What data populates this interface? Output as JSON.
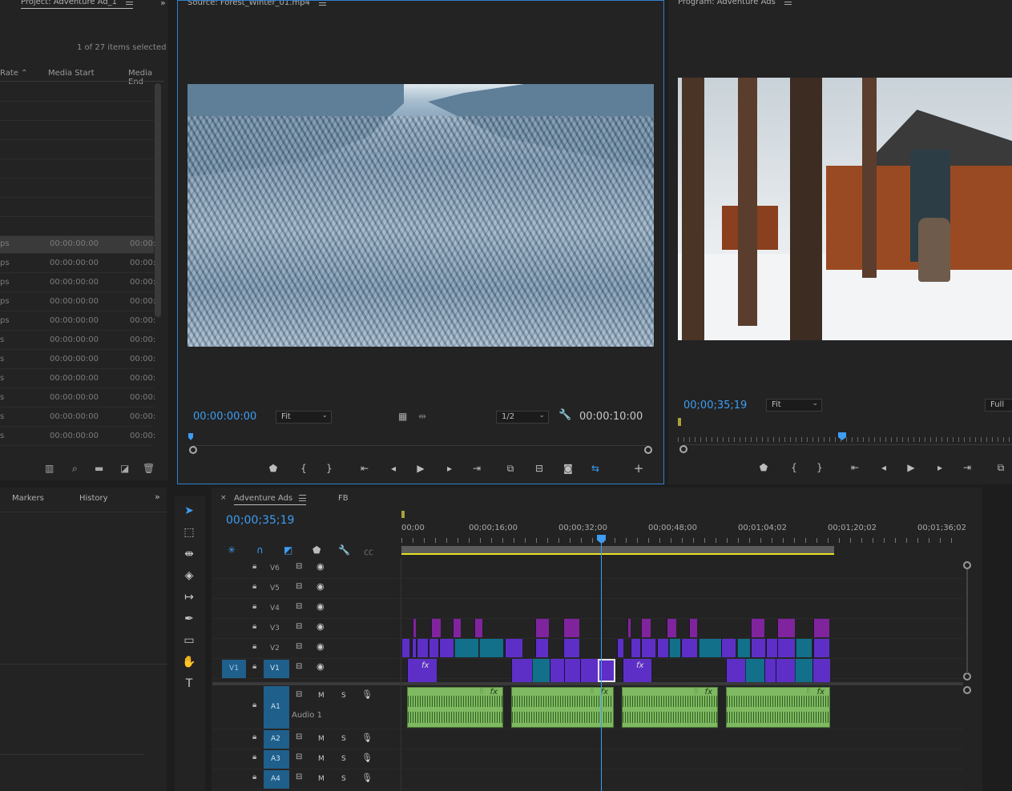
{
  "project": {
    "tab": "Project: Adventure Ad_1",
    "selection": "1 of 27 items selected",
    "columns": [
      "Rate",
      "Media Start",
      "Media End"
    ],
    "rows": [
      {
        "rate": "ps",
        "start": "00:00:00:00",
        "end": "00:00:"
      },
      {
        "rate": "ps",
        "start": "00:00:00:00",
        "end": "00:00:"
      },
      {
        "rate": "ps",
        "start": "00:00:00:00",
        "end": "00:00:"
      },
      {
        "rate": "ps",
        "start": "00:00:00:00",
        "end": "00:00:"
      },
      {
        "rate": "ps",
        "start": "00:00:00:00",
        "end": "00:00:"
      },
      {
        "rate": "s",
        "start": "00:00:00:00",
        "end": "00:00:"
      },
      {
        "rate": "s",
        "start": "00:00:00:00",
        "end": "00:00:"
      },
      {
        "rate": "s",
        "start": "00:00:00:00",
        "end": "00:00:"
      },
      {
        "rate": "s",
        "start": "00:00:00:00",
        "end": "00:00:"
      },
      {
        "rate": "s",
        "start": "00:00:00:00",
        "end": "00:00:"
      },
      {
        "rate": "s",
        "start": "00:00:00:00",
        "end": "00:00:"
      }
    ]
  },
  "source": {
    "tab": "Source: Forest_Winter_01.mp4",
    "timecode": "00:00:00:00",
    "fit": "Fit",
    "resolution": "1/2",
    "duration": "00:00:10:00"
  },
  "program": {
    "tab": "Program: Adventure Ads",
    "timecode": "00;00;35;19",
    "fit": "Fit",
    "resolution": "Full"
  },
  "lower_left": {
    "tabs": [
      "Markers",
      "History"
    ]
  },
  "timeline": {
    "tabs": [
      "Adventure Ads",
      "FB"
    ],
    "timecode": "00;00;35;19",
    "ruler": [
      "00;00",
      "00;00;16;00",
      "00;00;32;00",
      "00;00;48;00",
      "00;01;04;02",
      "00;01;20;02",
      "00;01;36;02"
    ],
    "video_tracks": [
      "V6",
      "V5",
      "V4",
      "V3",
      "V2",
      "V1"
    ],
    "source_patch": "V1",
    "audio_tracks": [
      "A1",
      "A2",
      "A3",
      "A4"
    ],
    "audio1_name": "Audio 1",
    "mute": "M",
    "solo": "S",
    "fx": "fx"
  }
}
